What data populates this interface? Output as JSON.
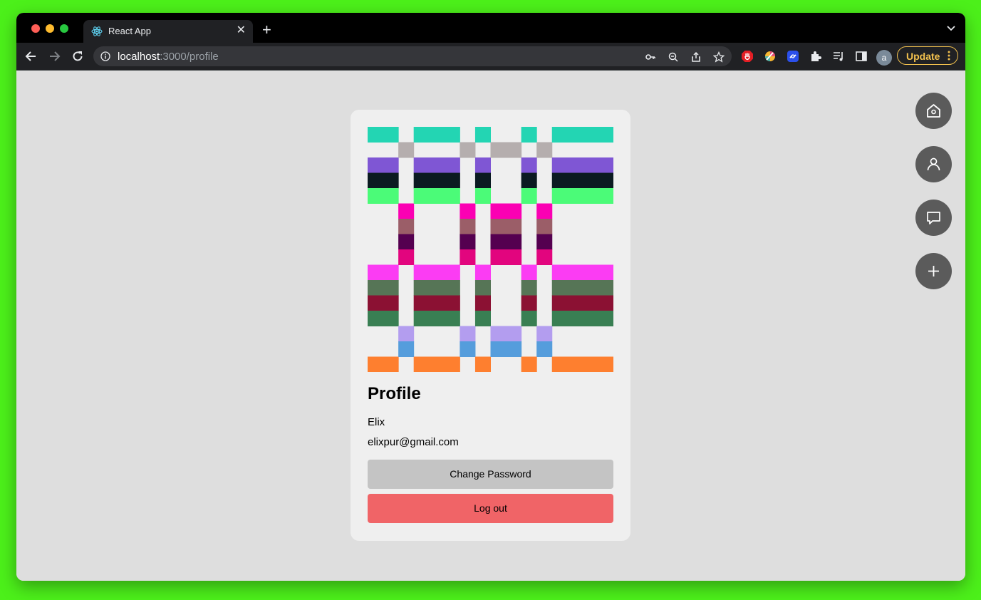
{
  "browser": {
    "tab": {
      "title": "React App",
      "close_icon": "close-icon",
      "favicon": "react-logo-icon"
    },
    "new_tab_icon": "plus-icon",
    "url_host": "localhost",
    "url_path": ":3000/profile",
    "avatar_letter": "a",
    "update_label": "Update",
    "extensions": [
      "adblock-icon",
      "color-picker-icon",
      "link-extension-icon",
      "puzzle-icon",
      "media-queue-icon",
      "side-panel-icon"
    ]
  },
  "profile": {
    "title": "Profile",
    "name": "Elix",
    "email": "elixpur@gmail.com",
    "change_password_label": "Change Password",
    "logout_label": "Log out"
  },
  "identicon": {
    "columns": [
      {
        "n": 2,
        "type": "A"
      },
      {
        "n": 1,
        "type": "B"
      },
      {
        "n": 3,
        "type": "A"
      },
      {
        "n": 1,
        "type": "B"
      },
      {
        "n": 1,
        "type": "A"
      },
      {
        "n": 2,
        "type": "B"
      },
      {
        "n": 1,
        "type": "A"
      },
      {
        "n": 1,
        "type": "B"
      },
      {
        "n": 4,
        "type": "A"
      }
    ],
    "rowsA": [
      "#23d5b3",
      null,
      "#7f56d4",
      "#0b1a21",
      "#4bfb78",
      null,
      null,
      null,
      null,
      "#fb3cf3",
      "#567556",
      "#8b1133",
      "#397f53",
      null,
      null,
      "#fe7f2f"
    ],
    "rowsB": [
      null,
      "#b5aeae",
      null,
      null,
      null,
      "#fb00b3",
      "#9b5e68",
      "#550050",
      "#e2057e",
      null,
      null,
      null,
      null,
      "#b39def",
      "#559ddc",
      null
    ]
  },
  "fabs": [
    "home-icon",
    "user-icon",
    "chat-icon",
    "plus-icon"
  ],
  "colors": {
    "accent_update": "#f2c14e",
    "logout": "#f06467",
    "change_password": "#c4c4c4",
    "fab": "#5b5b5b"
  }
}
